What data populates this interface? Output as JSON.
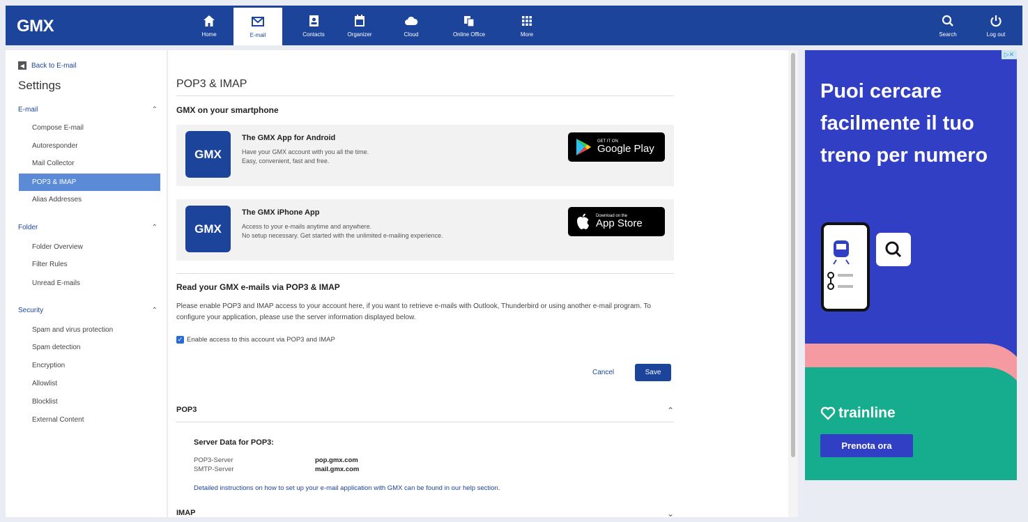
{
  "brand": {
    "logo": "GMX",
    "primary_color": "#1c449b",
    "accent_color": "#5b8bd6"
  },
  "nav": {
    "items": [
      {
        "label": "Home",
        "icon": "home-icon"
      },
      {
        "label": "E-mail",
        "icon": "mail-icon",
        "active": true
      },
      {
        "label": "Contacts",
        "icon": "contacts-icon"
      },
      {
        "label": "Organizer",
        "icon": "calendar-icon"
      },
      {
        "label": "Cloud",
        "icon": "cloud-icon"
      },
      {
        "label": "Online Office",
        "icon": "office-icon"
      },
      {
        "label": "More",
        "icon": "grid-icon"
      }
    ],
    "right": [
      {
        "label": "Search",
        "icon": "search-icon"
      },
      {
        "label": "Log out",
        "icon": "power-icon"
      }
    ]
  },
  "sidebar": {
    "back_label": "Back to E-mail",
    "title": "Settings",
    "sections": [
      {
        "label": "E-mail",
        "items": [
          "Compose E-mail",
          "Autoresponder",
          "Mail Collector",
          "POP3 & IMAP",
          "Alias Addresses"
        ]
      },
      {
        "label": "Folder",
        "items": [
          "Folder Overview",
          "Filter Rules",
          "Unread E-mails"
        ]
      },
      {
        "label": "Security",
        "items": [
          "Spam and virus protection",
          "Spam detection",
          "Encryption",
          "Allowlist",
          "Blocklist",
          "External Content"
        ]
      }
    ],
    "selected": "POP3 & IMAP"
  },
  "main": {
    "title": "POP3 & IMAP",
    "smartphone_heading": "GMX on your smartphone",
    "android": {
      "logo": "GMX",
      "name": "The GMX App for Android",
      "desc_1": "Have your GMX account with you all the time.",
      "desc_2": "Easy, convenient, fast and free.",
      "badge_small": "GET IT ON",
      "badge_big": "Google Play"
    },
    "iphone": {
      "logo": "GMX",
      "name": "The GMX iPhone App",
      "desc_1": "Access to your e-mails anytime and anywhere.",
      "desc_2": "No setup necessary. Get started with the unlimited e-mailing experience.",
      "badge_small": "Download on the",
      "badge_big": "App Store"
    },
    "read_heading": "Read your GMX e-mails via POP3 & IMAP",
    "read_text": "Please enable POP3 and IMAP access to your account here, if you want to retrieve e-mails with Outlook, Thunderbird or using another e-mail program. To configure your application, please use the server information displayed below.",
    "checkbox_label": "Enable access to this account via POP3 and IMAP",
    "checkbox_checked": true,
    "cancel_label": "Cancel",
    "save_label": "Save",
    "pop3_heading": "POP3",
    "server_title": "Server Data for POP3:",
    "servers": [
      {
        "key": "POP3-Server",
        "value": "pop.gmx.com"
      },
      {
        "key": "SMTP-Server",
        "value": "mail.gmx.com"
      }
    ],
    "help_text": "Detailed instructions on how to set up your e-mail application with GMX can be found in our help section.",
    "imap_heading": "IMAP"
  },
  "ad": {
    "headline": "Puoi cercare facilmente il tuo treno per numero",
    "brand": "trainline",
    "cta": "Prenota ora",
    "colors": {
      "bg": "#303fc4",
      "pink": "#f59aa0",
      "green": "#15ad8e"
    }
  }
}
